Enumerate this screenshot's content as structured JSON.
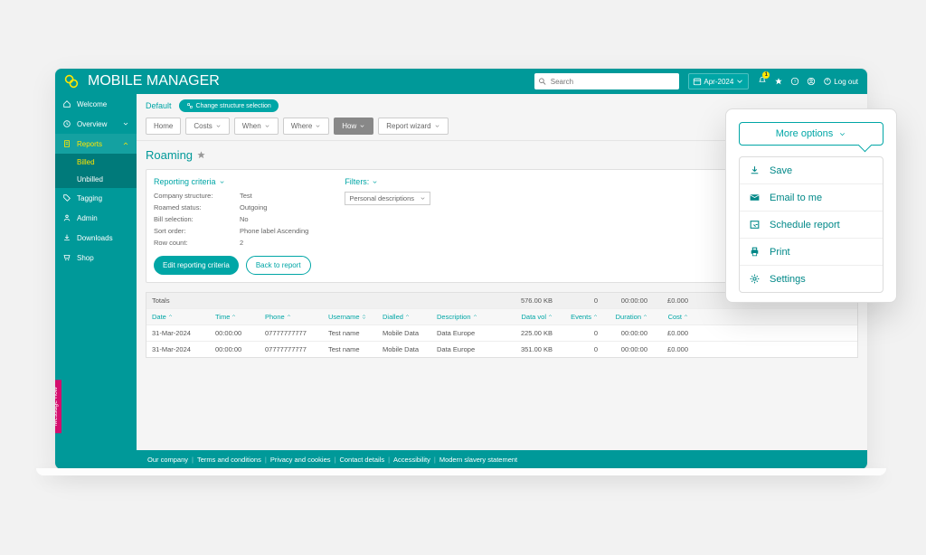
{
  "app_name": "MOBILE MANAGER",
  "search_placeholder": "Search",
  "date_label": "Apr-2024",
  "bell_count": "1",
  "logout_label": "Log out",
  "sidebar": {
    "items": [
      {
        "label": "Welcome"
      },
      {
        "label": "Overview"
      },
      {
        "label": "Reports"
      },
      {
        "label": "Tagging"
      },
      {
        "label": "Admin"
      },
      {
        "label": "Downloads"
      },
      {
        "label": "Shop"
      }
    ],
    "sub_reports": [
      {
        "label": "Billed"
      },
      {
        "label": "Unbilled"
      }
    ]
  },
  "message_now": "Message now",
  "crumb": {
    "default": "Default",
    "change_structure": "Change structure selection"
  },
  "tabs": [
    {
      "label": "Home"
    },
    {
      "label": "Costs"
    },
    {
      "label": "When"
    },
    {
      "label": "Where"
    },
    {
      "label": "How"
    },
    {
      "label": "Report wizard"
    }
  ],
  "page_title": "Roaming",
  "criteria": {
    "heading": "Reporting criteria",
    "rows": [
      {
        "label": "Company structure:",
        "value": "Test"
      },
      {
        "label": "Roamed status:",
        "value": "Outgoing"
      },
      {
        "label": "Bill selection:",
        "value": "No"
      },
      {
        "label": "Sort order:",
        "value": "Phone label Ascending"
      },
      {
        "label": "Row count:",
        "value": "2"
      }
    ],
    "edit_btn": "Edit reporting criteria",
    "back_btn": "Back to report"
  },
  "filters": {
    "heading": "Filters:",
    "select_label": "Personal descriptions"
  },
  "table": {
    "totals_label": "Totals",
    "totals": {
      "data_vol": "576.00 KB",
      "events": "0",
      "duration": "00:00:00",
      "cost": "£0.000"
    },
    "headers": {
      "date": "Date",
      "time": "Time",
      "phone": "Phone",
      "username": "Username",
      "dialled": "Dialled",
      "description": "Description",
      "data_vol": "Data vol",
      "events": "Events",
      "duration": "Duration",
      "cost": "Cost"
    },
    "rows": [
      {
        "date": "31-Mar-2024",
        "time": "00:00:00",
        "phone": "07777777777",
        "username": "Test name",
        "dialled": "Mobile Data",
        "description": "Data Europe",
        "data_vol": "225.00 KB",
        "events": "0",
        "duration": "00:00:00",
        "cost": "£0.000"
      },
      {
        "date": "31-Mar-2024",
        "time": "00:00:00",
        "phone": "07777777777",
        "username": "Test name",
        "dialled": "Mobile Data",
        "description": "Data Europe",
        "data_vol": "351.00 KB",
        "events": "0",
        "duration": "00:00:00",
        "cost": "£0.000"
      }
    ]
  },
  "footer": [
    "Our company",
    "Terms and conditions",
    "Privacy and cookies",
    "Contact details",
    "Accessibility",
    "Modern slavery statement"
  ],
  "popover": {
    "button": "More options",
    "items": [
      {
        "label": "Save"
      },
      {
        "label": "Email to me"
      },
      {
        "label": "Schedule report"
      },
      {
        "label": "Print"
      },
      {
        "label": "Settings"
      }
    ]
  }
}
